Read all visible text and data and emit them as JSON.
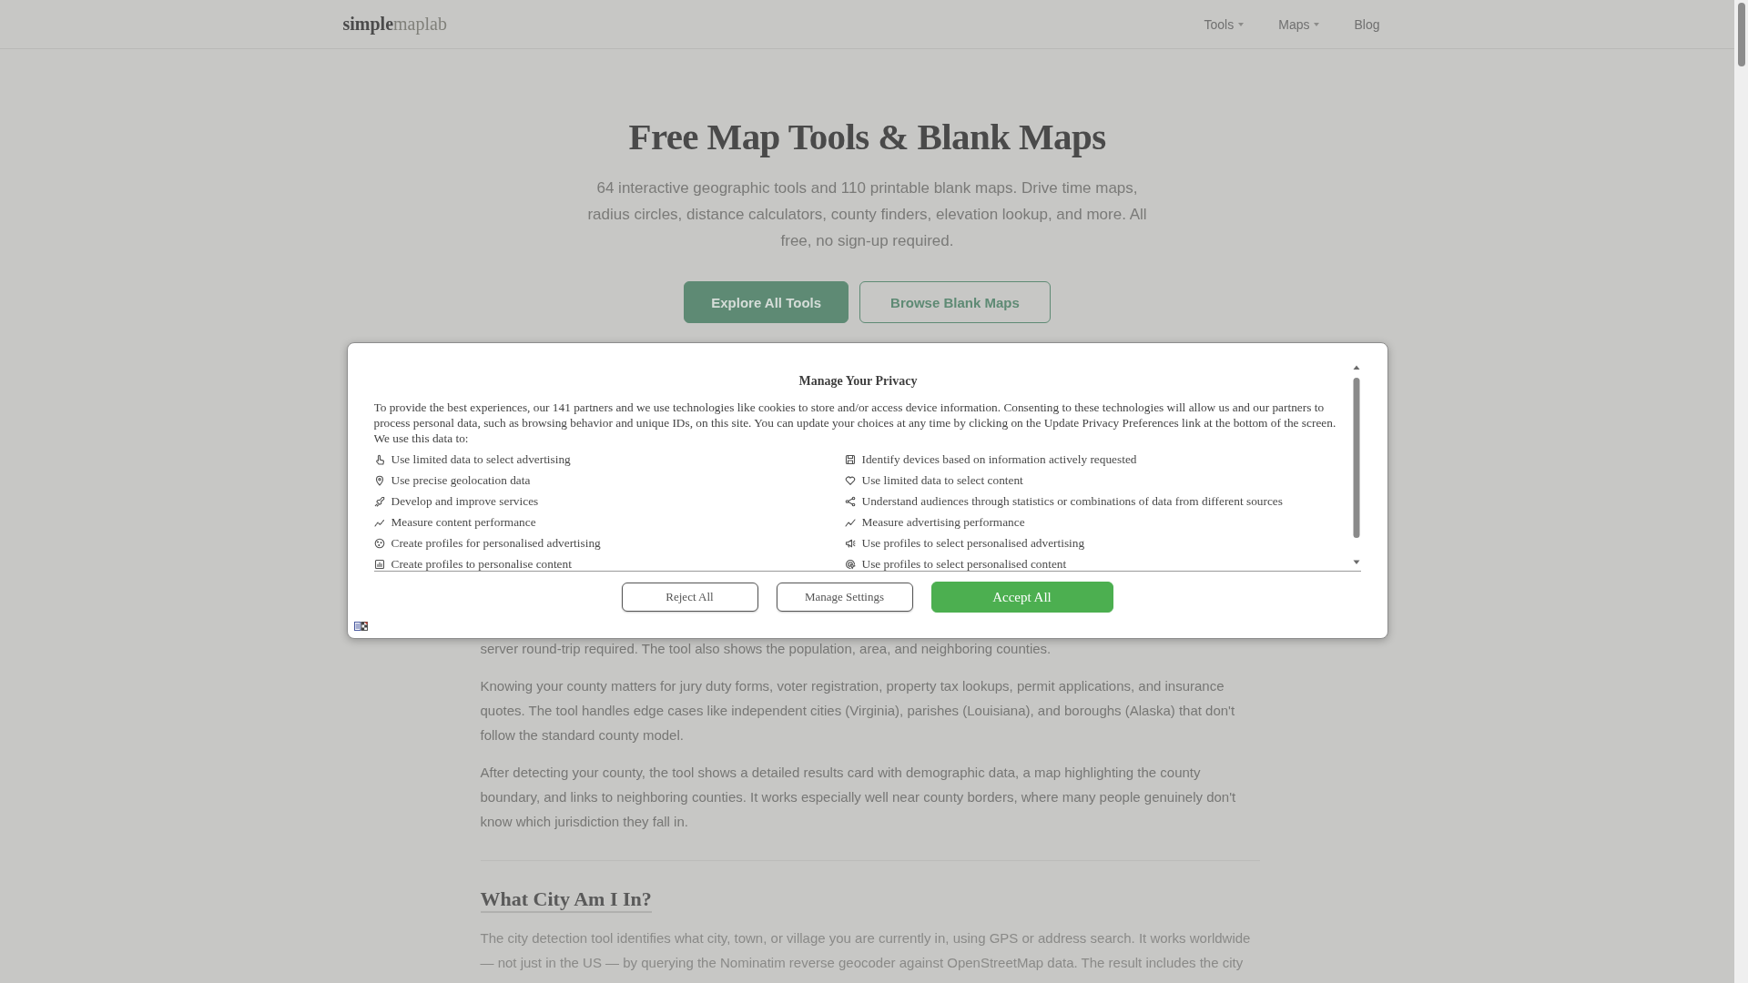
{
  "header": {
    "logo": "**simple**maplab",
    "nav": [
      {
        "label": "Tools",
        "dropdown": true
      },
      {
        "label": "Maps",
        "dropdown": true
      },
      {
        "label": "Blog",
        "dropdown": false
      }
    ]
  },
  "hero": {
    "title": "Free Map Tools & Blank Maps",
    "subtitle": "64 interactive geographic tools and 110 printable blank maps. Drive time maps, radius circles, distance calculators, county finders, elevation lookup, and more. All free, no sign-up required.",
    "buttons": [
      {
        "label": "Explore All Tools",
        "kind": "primary"
      },
      {
        "label": "Browse Blank Maps",
        "kind": "secondary"
      }
    ]
  },
  "article": {
    "paragraphs": [
      "server round-trip required. The tool also shows the population, area, and neighboring counties.",
      "Knowing your county matters for jury duty forms, voter registration, property tax lookups, permit applications, and insurance quotes. The tool handles edge cases like independent cities (Virginia), parishes (Louisiana), and boroughs (Alaska) that don't follow the standard county model.",
      "After detecting your county, the tool shows a detailed results card with demographic data, a map highlighting the county boundary, and links to neighboring counties. It works especially well near county borders, where many people genuinely don't know which jurisdiction they fall in."
    ],
    "sections": [
      {
        "heading": "What City Am I In?",
        "paragraphs": [
          "The city detection tool identifies what city, town, or village you are currently in, using GPS or address search. It works worldwide — not just in the US — by querying the Nominatim reverse geocoder against OpenStreetMap data. The result includes the city"
        ]
      }
    ]
  },
  "privacy_dialog": {
    "title": "Manage Your Privacy",
    "intro": "To provide the best experiences, our 141 partners and we use technologies like cookies to store and/or access device information. Consenting to these technologies will allow us and our partners to process personal data, such as browsing behavior and unique IDs, on this site. You can update your choices at any time by clicking on the Update Privacy Preferences link at the bottom of the screen. We use this data to:",
    "purposes": [
      "Use limited data to select advertising",
      "Identify devices based on information actively requested",
      "Use precise geolocation data",
      "Use limited data to select content",
      "Develop and improve services",
      "Understand audiences through statistics or combinations of data from different sources",
      "Measure content performance",
      "Measure advertising performance",
      "Create profiles for personalised advertising",
      "Use profiles to select personalised advertising",
      "Create profiles to personalise content",
      "Use profiles to select personalised content"
    ],
    "buttons": [
      {
        "label": "Reject All",
        "kind": "outline"
      },
      {
        "label": "Manage Settings",
        "kind": "outline"
      },
      {
        "label": "Accept All",
        "kind": "filled"
      }
    ]
  }
}
